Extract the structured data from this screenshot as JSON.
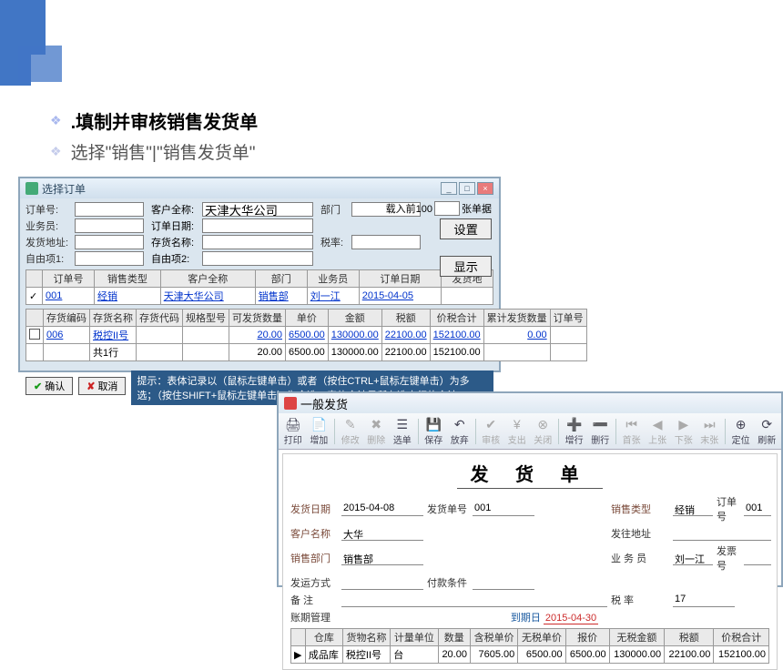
{
  "headings": {
    "main": ".填制并审核销售发货单",
    "sub": "选择\"销售\"|\"销售发货单\""
  },
  "win1": {
    "title": "选择订单",
    "labels": {
      "order_no": "订单号:",
      "salesman": "业务员:",
      "ship_addr": "发货地址:",
      "free1": "自由项1:",
      "cust_full": "客户全称:",
      "order_date": "订单日期:",
      "stock_name": "存货名称:",
      "free2": "自由项2:",
      "dept": "部门",
      "tax_rate": "税率:"
    },
    "cust_full_value": "天津大华公司",
    "right": {
      "load": "载入前100",
      "unit": "张单据",
      "settings": "设置",
      "display": "显示"
    },
    "table1_headers": [
      "",
      "订单号",
      "销售类型",
      "客户全称",
      "部门",
      "业务员",
      "订单日期",
      "发货地"
    ],
    "table1_row": {
      "order_no": "001",
      "sale_type": "经销",
      "cust": "天津大华公司",
      "dept": "销售部",
      "salesman": "刘一江",
      "date": "2015-04-05",
      "addr": ""
    },
    "table2_headers": [
      "",
      "存货编码",
      "存货名称",
      "存货代码",
      "规格型号",
      "可发货数量",
      "单价",
      "金额",
      "税额",
      "价税合计",
      "累计发货数量",
      "订单号"
    ],
    "table2_row": {
      "code": "006",
      "name": "税控II号",
      "qty": "20.00",
      "price": "6500.00",
      "amount": "130000.00",
      "tax": "22100.00",
      "total": "152100.00",
      "cum": "0.00",
      "order": ""
    },
    "table2_sum": {
      "label": "共1行",
      "qty": "20.00",
      "price": "6500.00",
      "amount": "130000.00",
      "tax": "22100.00",
      "total": "152100.00"
    },
    "hint": "提示：表体记录以（鼠标左键单击）或者（按住CTRL+鼠标左键单击）为多选；（按住SHIFT+鼠标左键单击）为全选；表体合计是所有选中行的合计。",
    "btn_ok": "确认",
    "btn_cancel": "取消"
  },
  "win2": {
    "title": "一般发货",
    "toolbar": {
      "print": "打印",
      "add": "增加",
      "modify": "修改",
      "delete": "删除",
      "select": "选单",
      "save": "保存",
      "abandon": "放弃",
      "audit": "审核",
      "payout": "支出",
      "close": "关闭",
      "detail": "增行",
      "delline": "删行",
      "first": "首张",
      "prev": "上张",
      "next": "下张",
      "last": "末张",
      "locate": "定位",
      "refresh": "刷新"
    },
    "doc_title": "发 货 单",
    "fields": {
      "ship_date_l": "发货日期",
      "ship_date_v": "2015-04-08",
      "ship_no_l": "发货单号",
      "ship_no_v": "001",
      "sale_type_l": "销售类型",
      "sale_type_v": "经销",
      "order_no_l": "订单号",
      "order_no_v": "001",
      "cust_name_l": "客户名称",
      "cust_name_v": "大华",
      "ship_addr_l": "发往地址",
      "ship_addr_v": "",
      "sale_dept_l": "销售部门",
      "sale_dept_v": "销售部",
      "salesman_l": "业 务 员",
      "salesman_v": "刘一江",
      "invoice_l": "发票号",
      "invoice_v": "",
      "ship_way_l": "发运方式",
      "ship_way_v": "",
      "pay_term_l": "付款条件",
      "pay_term_v": "",
      "remark_l": "备  注",
      "remark_v": "",
      "tax_rate_l": "税  率",
      "tax_rate_v": "17",
      "credit_l": "账期管理",
      "due_l": "到期日",
      "due_v": "2015-04-30"
    },
    "grid_headers": [
      "",
      "仓库",
      "货物名称",
      "计量单位",
      "数量",
      "含税单价",
      "无税单价",
      "报价",
      "无税金额",
      "税额",
      "价税合计"
    ],
    "grid_row": {
      "wh": "成品库",
      "name": "税控II号",
      "unit": "台",
      "qty": "20.00",
      "inc_price": "7605.00",
      "ex_price": "6500.00",
      "quote": "6500.00",
      "ex_amt": "130000.00",
      "tax": "22100.00",
      "total": "152100.00"
    }
  }
}
